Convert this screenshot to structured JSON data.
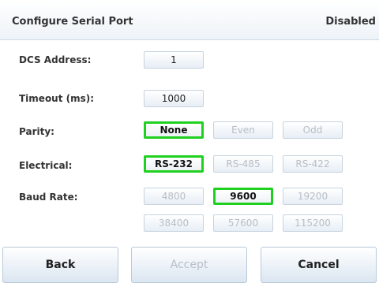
{
  "header": {
    "title": "Configure Serial Port",
    "status": "Disabled"
  },
  "dcs": {
    "label": "DCS Address:",
    "value": "1"
  },
  "timeout": {
    "label": "Timeout (ms):",
    "value": "1000"
  },
  "parity": {
    "label": "Parity:",
    "options": [
      "None",
      "Even",
      "Odd"
    ],
    "selected": "None"
  },
  "electrical": {
    "label": "Electrical:",
    "options": [
      "RS-232",
      "RS-485",
      "RS-422"
    ],
    "selected": "RS-232"
  },
  "baud": {
    "label": "Baud Rate:",
    "options": [
      "4800",
      "9600",
      "19200",
      "38400",
      "57600",
      "115200"
    ],
    "selected": "9600"
  },
  "footer": {
    "back": "Back",
    "accept": "Accept",
    "cancel": "Cancel"
  },
  "colors": {
    "selection": "#20d020",
    "header_bg": "#eef3f8",
    "disabled_text": "#b7bec6"
  }
}
